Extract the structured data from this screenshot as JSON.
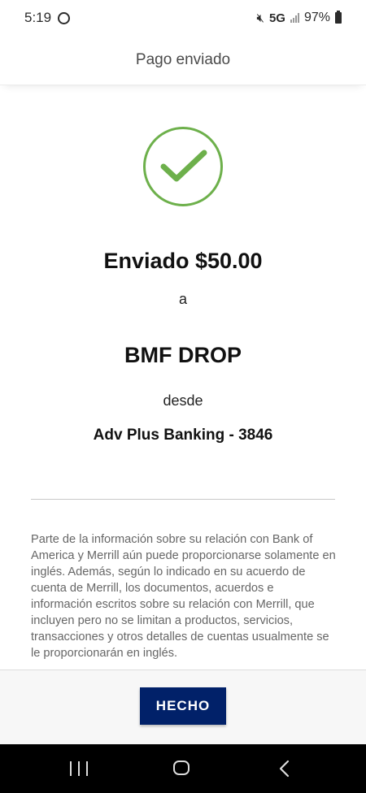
{
  "status_bar": {
    "time": "5:19",
    "network": "5G",
    "battery": "97%"
  },
  "header": {
    "title": "Pago enviado"
  },
  "confirmation": {
    "amount_text": "Enviado $50.00",
    "to_word": "a",
    "recipient": "BMF DROP",
    "from_word": "desde",
    "account": "Adv Plus Banking - 3846",
    "check_color": "#6db04b"
  },
  "disclaimer": {
    "text": "Parte de la información sobre su relación con Bank of America y Merrill aún puede proporcionarse solamente en inglés. Además, según lo indicado en su acuerdo de cuenta de Merrill, los documentos, acuerdos e información escritos sobre su relación con Merrill, que incluyen pero no se limitan a productos, servicios, transacciones y otros detalles de cuentas usualmente se le proporcionarán en inglés."
  },
  "footer": {
    "done_label": "HECHO",
    "button_color": "#012169"
  },
  "nav_bar": {
    "icons": [
      "recents-icon",
      "home-icon",
      "back-icon"
    ]
  }
}
